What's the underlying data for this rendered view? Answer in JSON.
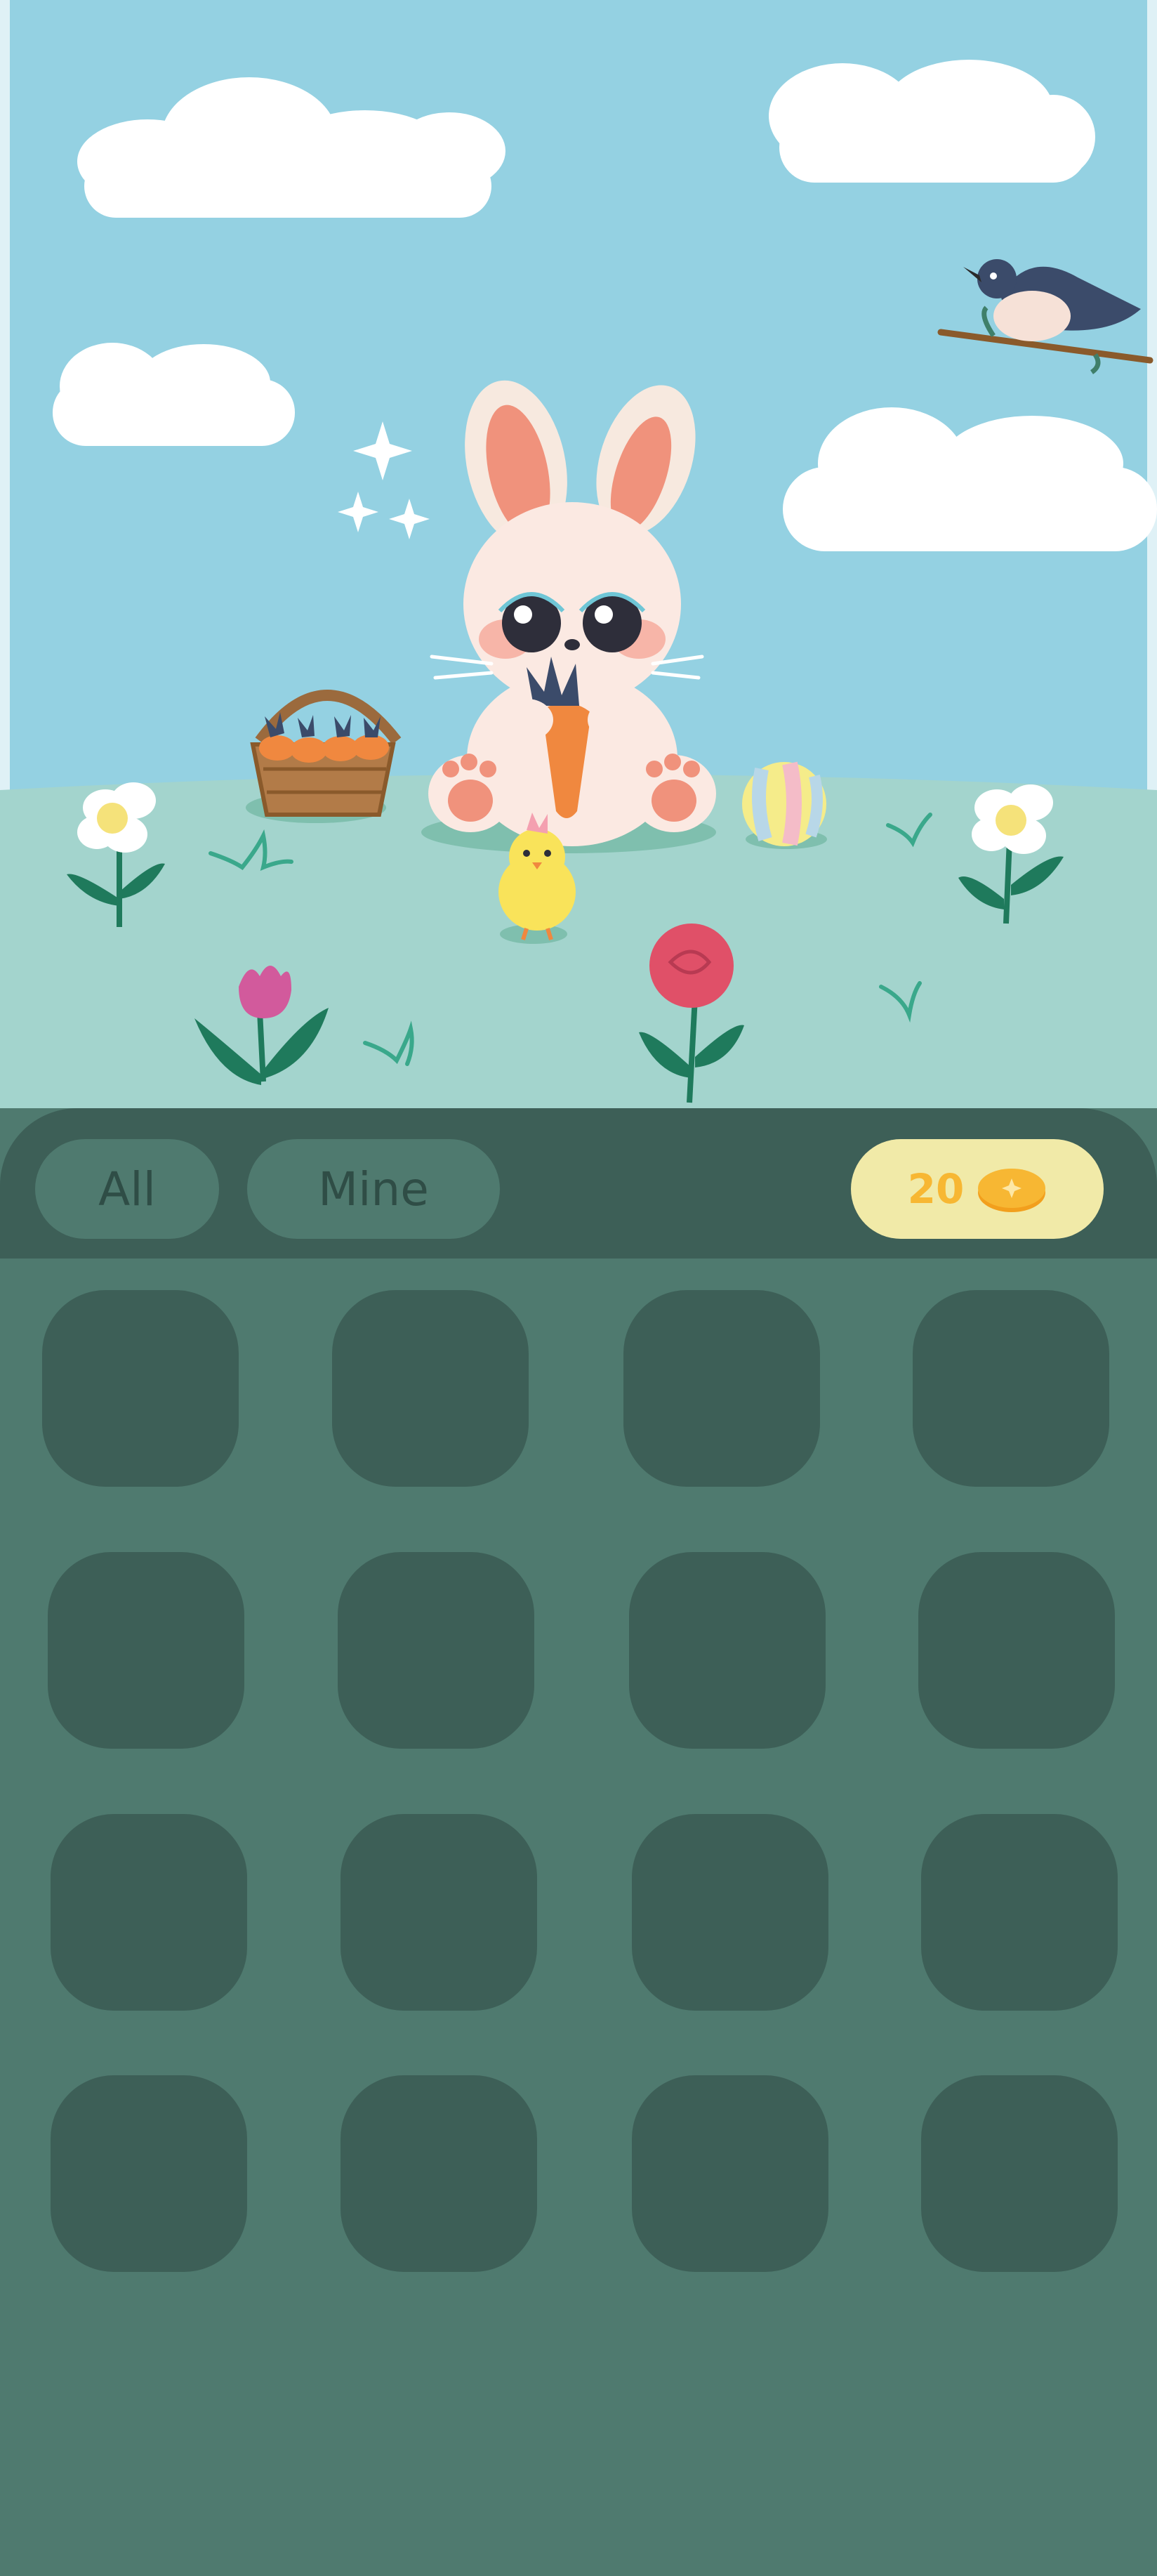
{
  "scene": {
    "characters": [
      "bunny",
      "chick",
      "bird"
    ],
    "objects": [
      "carrot-basket",
      "ball",
      "sparkles",
      "flowers",
      "clouds"
    ]
  },
  "tabs": [
    {
      "label": "All",
      "icon": ""
    },
    {
      "label": "Mine",
      "icon": ""
    }
  ],
  "wallet": {
    "count": "20",
    "icon": "coin-icon"
  },
  "grid": {
    "rows": 4,
    "columns": 4,
    "slots_icon": "empty-slot"
  },
  "colors": {
    "sky": "#94d1e2",
    "grass": "#a3d4cd",
    "panel": "#4f7a6f",
    "panel_dark": "#3d5f57",
    "pill": "#f1eaa8",
    "coin": "#f7b733"
  }
}
